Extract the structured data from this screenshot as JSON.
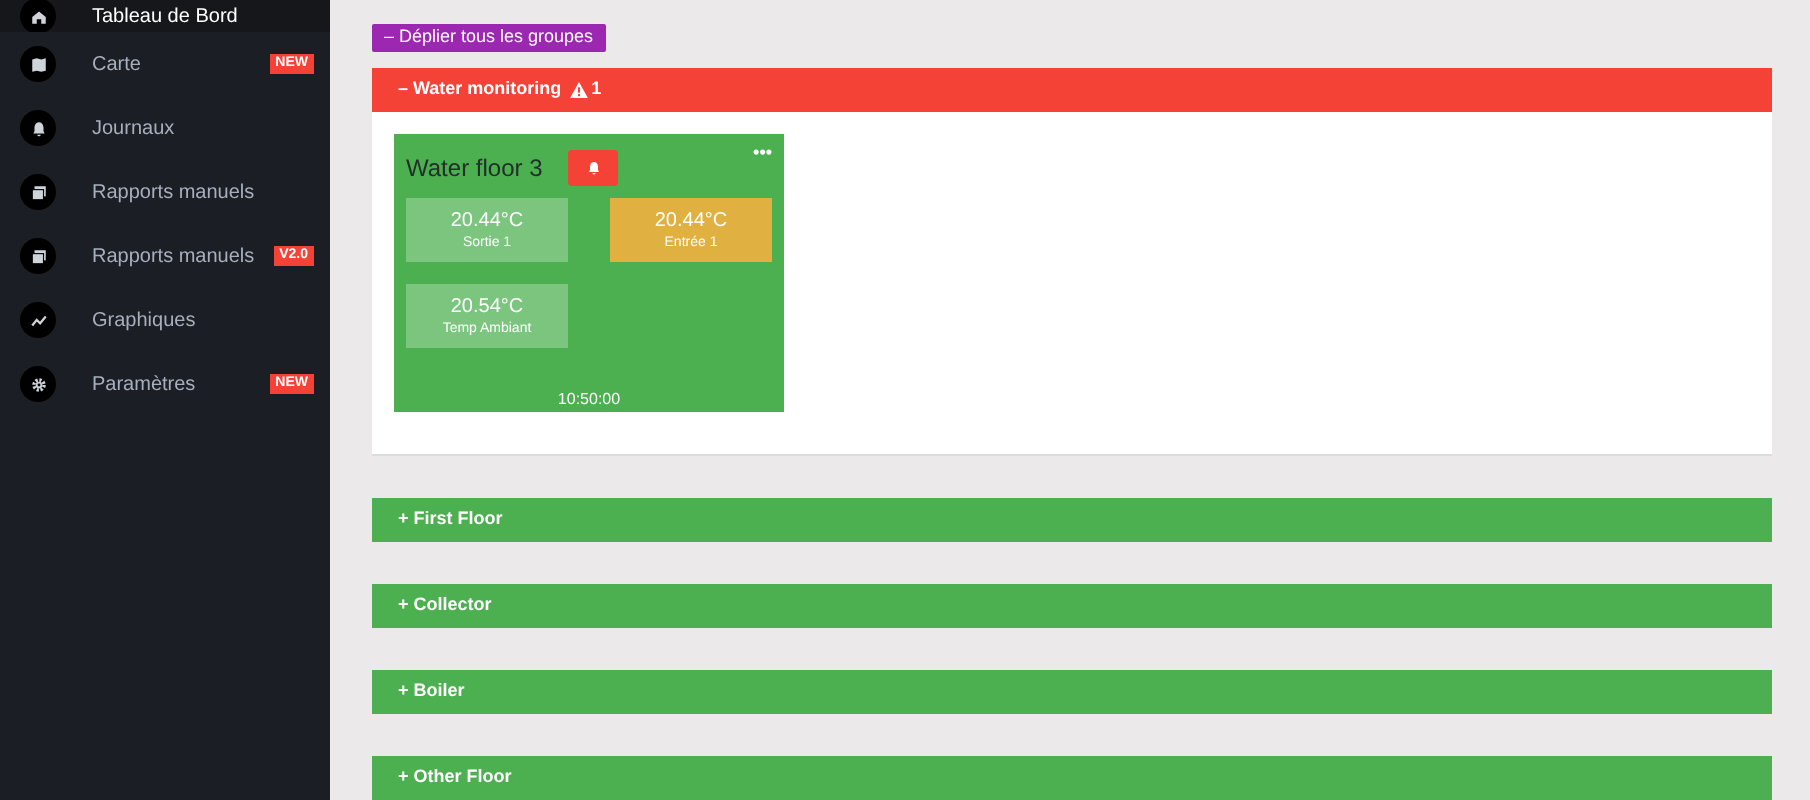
{
  "sidebar": {
    "items": [
      {
        "label": "Tableau de Bord",
        "kind": "home",
        "selected": true
      },
      {
        "label": "Carte",
        "kind": "map",
        "selected": false,
        "badge": "NEW"
      },
      {
        "label": "Journaux",
        "kind": "bell",
        "selected": false
      },
      {
        "label": "Rapports manuels",
        "kind": "report",
        "selected": false
      },
      {
        "label": "Rapports manuels",
        "kind": "report",
        "selected": false,
        "badge": "V2.0"
      },
      {
        "label": "Graphiques",
        "kind": "chart",
        "selected": false
      },
      {
        "label": "Paramètres",
        "kind": "gear",
        "selected": false,
        "badge": "NEW"
      }
    ]
  },
  "toggle_all_button": "– Déplier tous les groupes",
  "groups": [
    {
      "sign": "–",
      "name": "Water monitoring",
      "alert": true,
      "alert_count": "1",
      "cards": [
        {
          "title": "Water floor 3",
          "menu": "•••",
          "alarm": true,
          "time": "10:50:00",
          "tiles": [
            {
              "value": "20.44°C",
              "label": "Sortie 1",
              "kind": "normal"
            },
            {
              "value": "20.44°C",
              "label": "Entrée 1",
              "kind": "warning"
            },
            {
              "value": "20.54°C",
              "label": "Temp Ambiant",
              "kind": "normal"
            }
          ]
        }
      ]
    },
    {
      "sign": "+",
      "name": "First Floor",
      "alert": false
    },
    {
      "sign": "+",
      "name": "Collector",
      "alert": false
    },
    {
      "sign": "+",
      "name": "Boiler",
      "alert": false
    },
    {
      "sign": "+",
      "name": "Other Floor",
      "alert": false
    }
  ]
}
